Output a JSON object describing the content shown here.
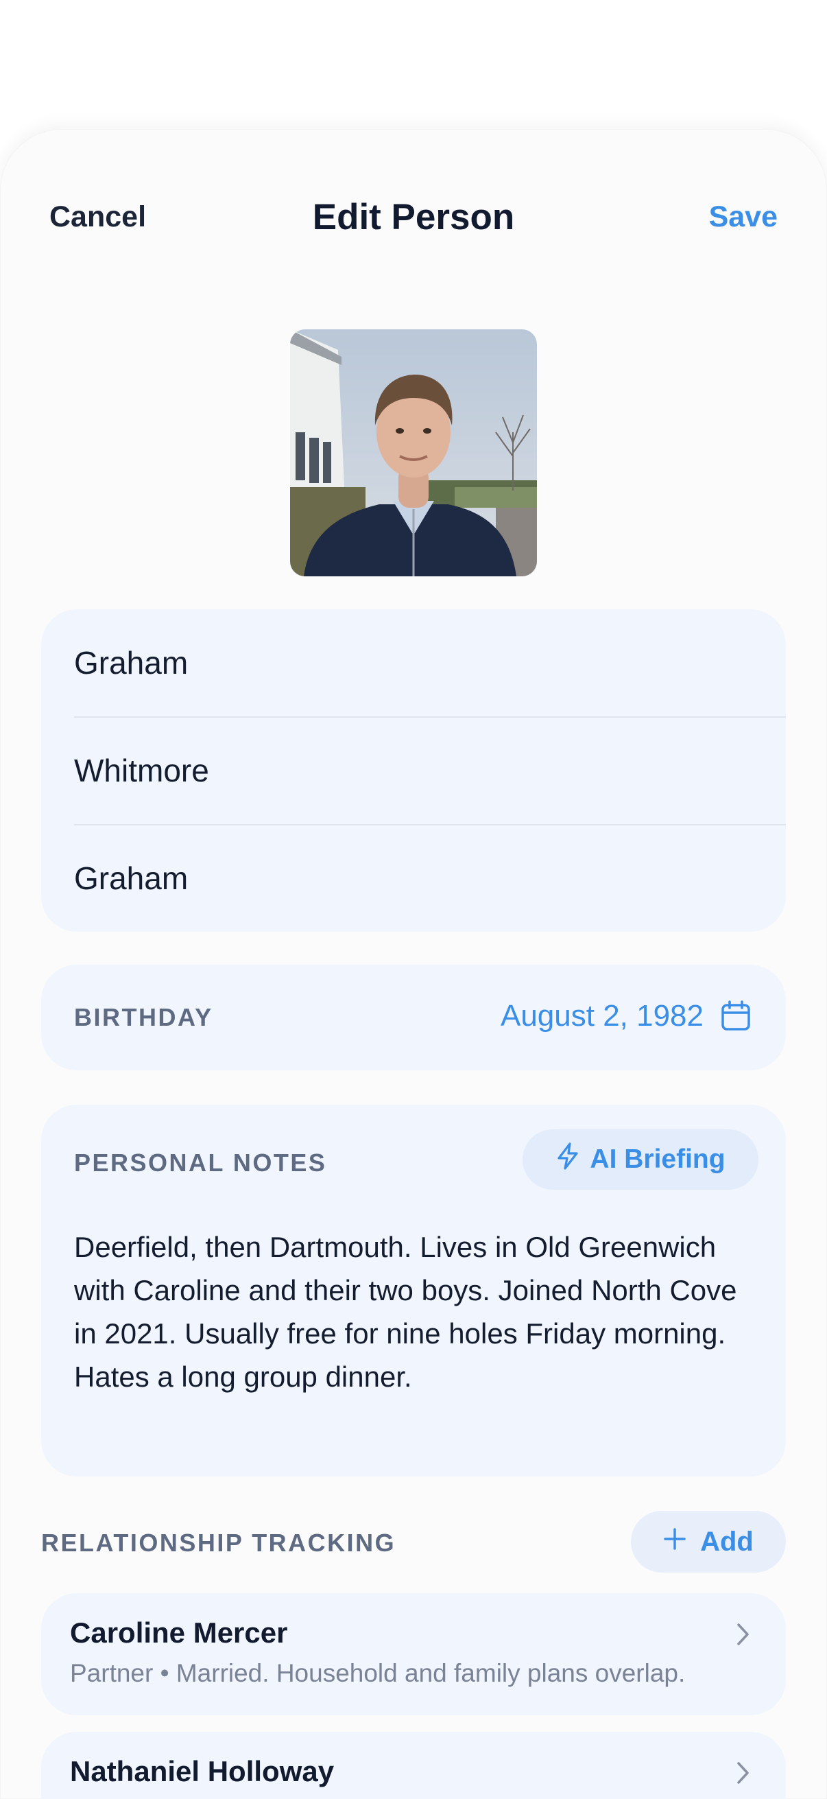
{
  "nav": {
    "cancel_label": "Cancel",
    "title": "Edit Person",
    "save_label": "Save"
  },
  "name_fields": {
    "first": "Graham",
    "last": "Whitmore",
    "preferred": "Graham"
  },
  "birthday": {
    "label": "BIRTHDAY",
    "value": "August 2, 1982",
    "icon": "calendar-icon"
  },
  "notes": {
    "label": "PERSONAL NOTES",
    "ai_button_label": "AI Briefing",
    "ai_icon": "lightning-icon",
    "text": "Deerfield, then Dartmouth. Lives in Old Greenwich with Caroline and their two boys. Joined North Cove in 2021. Usually free for nine holes Friday morning. Hates a long group dinner."
  },
  "relationships": {
    "label": "RELATIONSHIP TRACKING",
    "add_label": "Add",
    "items": [
      {
        "name": "Caroline Mercer",
        "subtitle": "Partner • Married. Household and family plans overlap."
      },
      {
        "name": "Nathaniel Holloway",
        "subtitle": ""
      }
    ]
  },
  "colors": {
    "accent": "#3a8ee6",
    "card_background": "#f1f5fd",
    "label_gray": "#5d6a82"
  }
}
